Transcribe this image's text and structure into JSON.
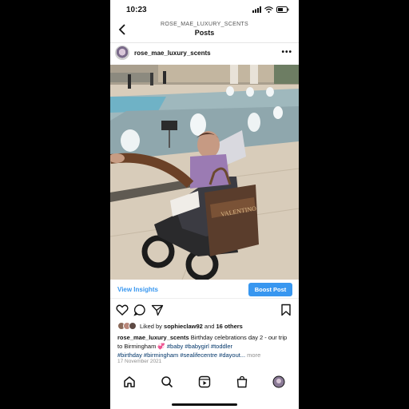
{
  "status": {
    "time": "10:23"
  },
  "header": {
    "username": "ROSE_MAE_LUXURY_SCENTS",
    "title": "Posts"
  },
  "post": {
    "username": "rose_mae_luxury_scents",
    "more": "•••",
    "photo_alt_colors": {
      "sky": "#c9c2b6",
      "water": "#7fa9b5",
      "paving": "#d7cbb9"
    }
  },
  "insights": {
    "link": "View Insights",
    "boost": "Boost Post"
  },
  "likes": {
    "prefix": "Liked by ",
    "user": "sophieclaw92",
    "middle": " and ",
    "others": "16 others"
  },
  "caption": {
    "user": "rose_mae_luxury_scents",
    "text": " Birthday celebrations day 2 - our trip to Birmingham 💞 ",
    "tags_line1": "#baby #babygirl #toddler",
    "tags_line2": "#birthday #birmingham #sealifecentre #dayout...",
    "more": " more"
  },
  "date": "17 November 2021",
  "icons": [
    "back-icon",
    "more-icon",
    "heart-icon",
    "comment-icon",
    "share-icon",
    "bookmark-icon",
    "home-icon",
    "search-icon",
    "reels-icon",
    "shop-icon",
    "profile-icon"
  ],
  "colors": {
    "accent": "#3897f0",
    "hashtag": "#003569"
  }
}
